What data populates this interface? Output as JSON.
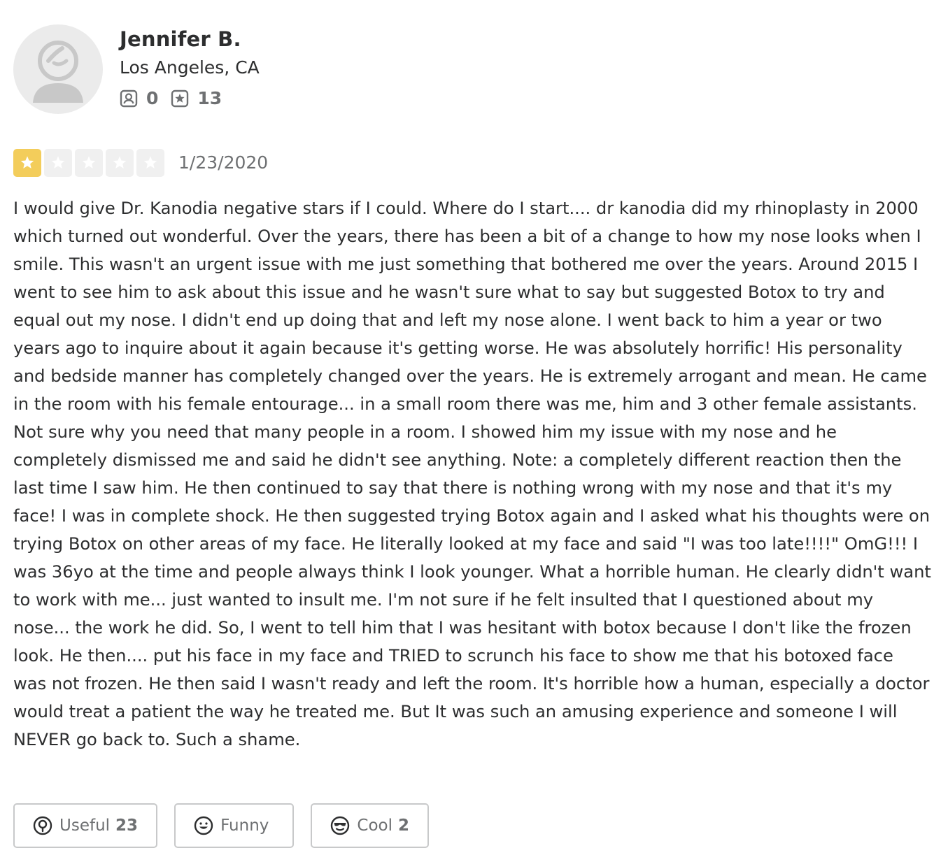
{
  "reviewer": {
    "name": "Jennifer B.",
    "location": "Los Angeles, CA",
    "friends_count": "0",
    "reviews_count": "13",
    "avatar_icon": "default-avatar-icon",
    "friends_icon": "friends-icon",
    "reviews_icon": "review-star-icon"
  },
  "rating": {
    "stars": 1,
    "max_stars": 5,
    "date": "1/23/2020",
    "filled_color": "#f3cd5b",
    "empty_color": "#f0f0f0"
  },
  "review": {
    "text": "I would give Dr. Kanodia negative stars if I could. Where do I start.... dr kanodia did my rhinoplasty in 2000 which turned out wonderful. Over the years, there has been a bit of a change to how my nose looks when I smile. This wasn't an urgent issue with me just something that bothered me over the years. Around 2015 I went to see him to ask about this issue and he wasn't sure what to say but suggested Botox to try and equal out my nose. I didn't end up doing that and left my nose alone. I went back to him a year or two years ago to inquire about it again because it's getting worse. He was absolutely horrific! His personality and bedside manner has completely changed over the years. He is extremely arrogant and mean. He came in the room with his female entourage... in a small room there was me, him and 3 other female assistants. Not sure why you need that many people in a room. I showed him my issue with my nose and he completely dismissed me and said he didn't see anything. Note: a completely different reaction then the last time I saw him. He then continued to say that there is nothing wrong with my nose and that it's my face! I was in complete shock. He then suggested trying Botox again and I asked what his thoughts were on trying Botox on other areas of my face. He literally looked at my face and said \"I was too late!!!!\" OmG!!! I was 36yo at the time and people always think I look younger. What a horrible human. He clearly didn't want to work with me... just wanted to insult me. I'm not sure if he felt insulted that I questioned about my nose... the work he did. So, I went to tell him that I was hesitant with botox because I don't like the frozen look. He then.... put his face in my face and TRIED to scrunch his face to show me that his botoxed face was not frozen. He then said I wasn't ready and left the room. It's horrible how a human, especially a doctor would treat a patient the way he treated me. But It was such an amusing experience and someone I will NEVER go back to. Such a shame."
  },
  "reactions": {
    "useful": {
      "label": "Useful",
      "count": "23",
      "icon": "lightbulb-icon"
    },
    "funny": {
      "label": "Funny",
      "count": "",
      "icon": "smile-icon"
    },
    "cool": {
      "label": "Cool",
      "count": "2",
      "icon": "sunglasses-icon"
    }
  }
}
